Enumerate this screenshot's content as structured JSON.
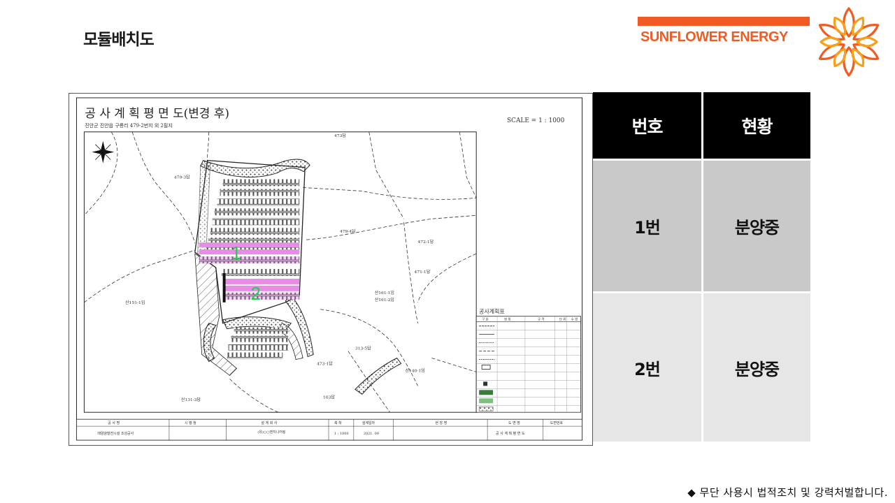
{
  "page_title": "모듈배치도",
  "brand": {
    "name": "SUNFLOWER ENERGY",
    "accent_color": "#f15a22"
  },
  "drawing": {
    "title": "공 사 계 획 평 면 도(변경 후)",
    "address": "진안군 진안읍 구룡리 479-2번지 외 2필지",
    "scale": "SCALE = 1 : 1000",
    "section_labels": [
      "1",
      "2"
    ],
    "parcels": [
      "479-3답",
      "479-4답",
      "473답",
      "472-1답",
      "471-1답",
      "산151-1임",
      "산161-1임",
      "산161-2임",
      "313-5답",
      "473-1답",
      "산140-1임",
      "산131-3답",
      "163답"
    ],
    "legend_title": "공사계획표",
    "legend_header": [
      "구 분",
      "명 칭",
      "규 격",
      "단 위",
      "수 량"
    ],
    "title_block": {
      "headers": [
        "공 사 명",
        "시 행 청",
        "설 계 회 사",
        "축 척",
        "설계일자",
        "현 장 명",
        "도 면 명",
        "도면번호"
      ],
      "project": "태양광발전시설 조성공사",
      "company": "(유)○○엔지니어링",
      "scale": "1 : 1000",
      "date": "2021. 09",
      "sheet": "공 사 계 획 평 면 도"
    }
  },
  "status_table": {
    "headers": [
      "번호",
      "현황"
    ],
    "rows": [
      {
        "no": "1번",
        "status": "분양중"
      },
      {
        "no": "2번",
        "status": "분양중"
      }
    ]
  },
  "footer_note": "◆ 무단 사용시 법적조치 및 강력처벌합니다."
}
